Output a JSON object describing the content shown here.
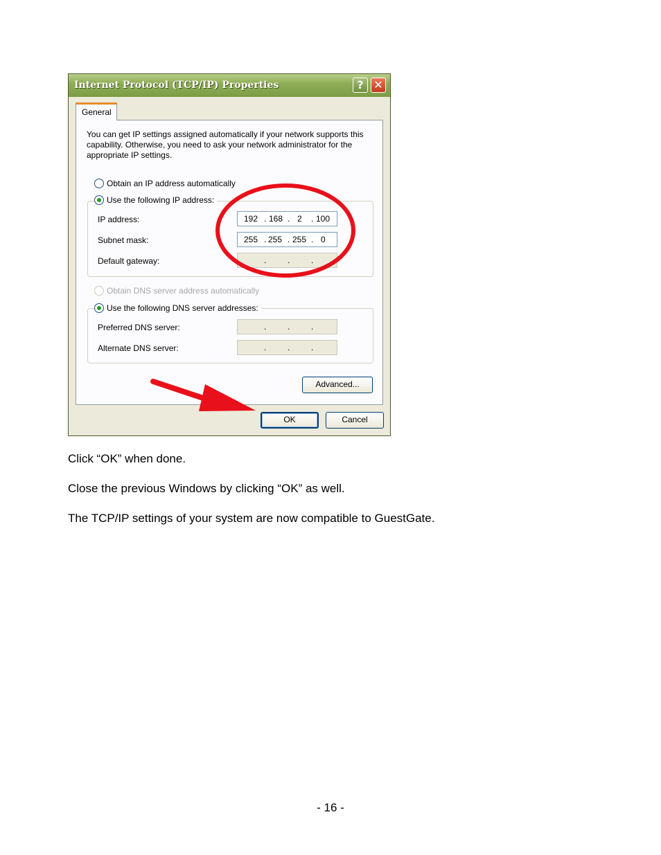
{
  "dialog": {
    "title": "Internet Protocol (TCP/IP) Properties",
    "help_glyph": "?",
    "close_glyph": "✕",
    "tab_label": "General",
    "description": "You can get IP settings assigned automatically if your network supports this capability. Otherwise, you need to ask your network administrator for the appropriate IP settings.",
    "ip_auto_label": "Obtain an IP address automatically",
    "ip_manual_label": "Use the following IP address:",
    "ip_label": "IP address:",
    "ip_octets": [
      "192",
      "168",
      "2",
      "100"
    ],
    "subnet_label": "Subnet mask:",
    "subnet_octets": [
      "255",
      "255",
      "255",
      "0"
    ],
    "gateway_label": "Default gateway:",
    "dns_auto_label": "Obtain DNS server address automatically",
    "dns_manual_label": "Use the following DNS server addresses:",
    "preferred_dns_label": "Preferred DNS server:",
    "alternate_dns_label": "Alternate DNS server:",
    "advanced_label": "Advanced...",
    "ok_label": "OK",
    "cancel_label": "Cancel",
    "dot": "."
  },
  "annotations": {
    "color": "#e8101a"
  },
  "instructions": [
    "Click “OK” when done.",
    "Close the previous Windows by clicking “OK” as well.",
    "The TCP/IP settings of your system are now compatible to GuestGate."
  ],
  "page_number": "- 16 -"
}
